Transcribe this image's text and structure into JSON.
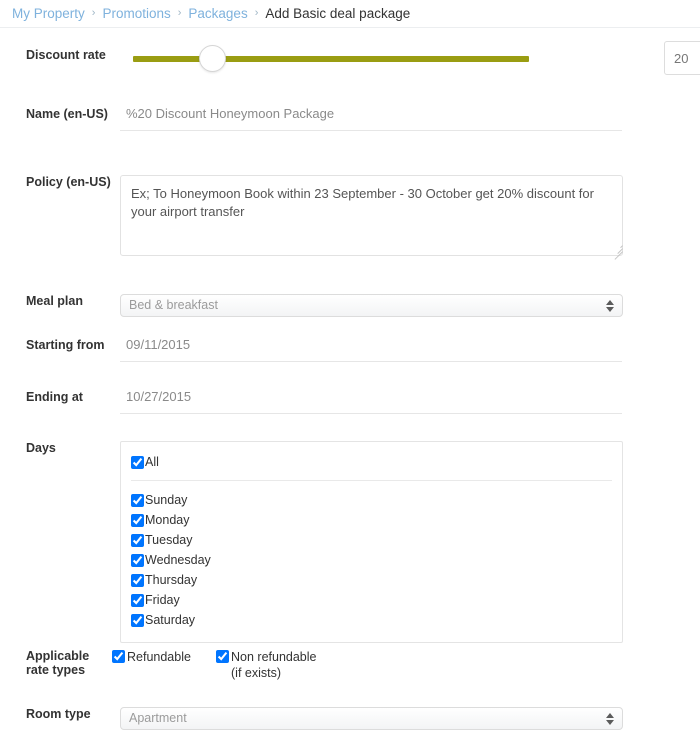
{
  "breadcrumb": {
    "items": [
      {
        "label": "My Property",
        "current": false
      },
      {
        "label": "Promotions",
        "current": false
      },
      {
        "label": "Packages",
        "current": false
      },
      {
        "label": "Add Basic deal package",
        "current": true
      }
    ],
    "separator": "›",
    "link_color": "#7fb2dd",
    "current_color": "#333333"
  },
  "form": {
    "discount": {
      "label": "Discount rate",
      "value": "20",
      "unit": "%",
      "slider_percent": 20,
      "slider_color": "#9a9d12"
    },
    "name": {
      "label": "Name (en-US)",
      "value": "%20 Discount Honeymoon Package",
      "placeholder": "Name (en-US)"
    },
    "policy": {
      "label": "Policy (en-US)",
      "value": "Ex; To Honeymoon Book within 23 September - 30 October get 20% discount for your airport transfer",
      "placeholder": "Policy (en-US)"
    },
    "meal_plan": {
      "label": "Meal plan",
      "selected": "Bed & breakfast",
      "options": [
        "Bed & breakfast"
      ]
    },
    "starting_from": {
      "label": "Starting from",
      "value": "09/11/2015",
      "placeholder": "Starting from"
    },
    "ending_at": {
      "label": "Ending at",
      "value": "10/27/2015",
      "placeholder": "Ending at"
    },
    "days": {
      "label": "Days",
      "all": {
        "label": "All",
        "checked": true
      },
      "items": [
        {
          "label": "Sunday",
          "checked": true
        },
        {
          "label": "Monday",
          "checked": true
        },
        {
          "label": "Tuesday",
          "checked": true
        },
        {
          "label": "Wednesday",
          "checked": true
        },
        {
          "label": "Thursday",
          "checked": true
        },
        {
          "label": "Friday",
          "checked": true
        },
        {
          "label": "Saturday",
          "checked": true
        }
      ]
    },
    "rate_types": {
      "label": "Applicable rate types",
      "items": [
        {
          "label": "Refundable",
          "checked": true
        },
        {
          "label": "Non refundable (if exists)",
          "checked": true
        }
      ]
    },
    "room_type": {
      "label": "Room type",
      "selected": "Apartment",
      "options": [
        "Apartment"
      ]
    }
  }
}
